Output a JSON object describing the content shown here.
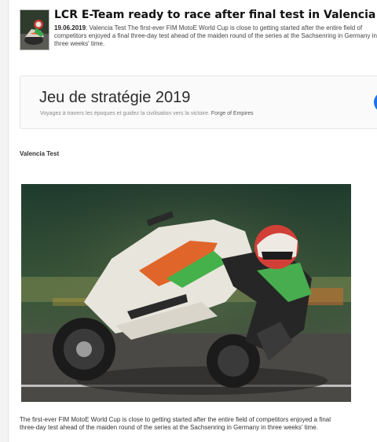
{
  "article": {
    "title": "LCR E-Team ready to race after final test in Valencia",
    "date": "19.06.2019",
    "summary": ": Valencia Test The first-ever FIM MotoE World Cup is close to getting started after the entire field of competitors enjoyed a final three-day test ahead of the maiden round of the series at the Sachsenring in Germany in three weeks' time."
  },
  "ad": {
    "title": "Jeu de stratégie 2019",
    "description": "Voyagez à travers les époques et guidez la civilisation vers la victoire.",
    "brand": "Forge of Empires",
    "button_color": "#1a73e8"
  },
  "section": {
    "heading": "Valencia Test"
  },
  "photo": {
    "subject": "motorcycle-racer"
  },
  "caption": {
    "line1": "The first-ever FIM MotoE World Cup is close to getting started after the entire field of competitors enjoyed a final",
    "line2": "three-day test ahead of the maiden round of the series at the Sachsenring in Germany in three weeks' time."
  }
}
